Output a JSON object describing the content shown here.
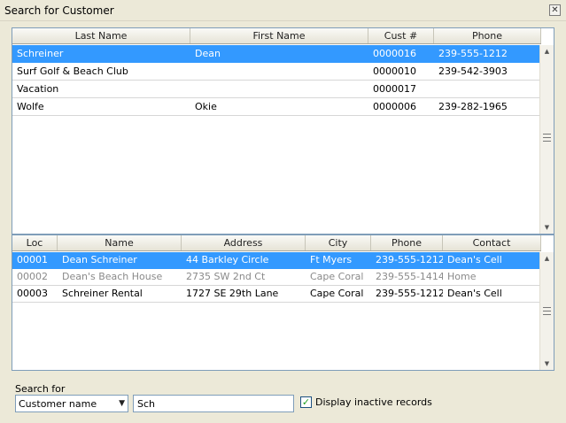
{
  "window": {
    "title": "Search for Customer",
    "close_glyph": "✕"
  },
  "customers": {
    "columns": [
      "Last Name",
      "First Name",
      "Cust #",
      "Phone"
    ],
    "rows": [
      {
        "last": "Schreiner",
        "first": "Dean",
        "cust": "0000016",
        "phone": "239-555-1212",
        "selected": true
      },
      {
        "last": "Surf Golf & Beach Club",
        "first": "",
        "cust": "0000010",
        "phone": "239-542-3903",
        "selected": false
      },
      {
        "last": "Vacation",
        "first": "",
        "cust": "0000017",
        "phone": "",
        "selected": false
      },
      {
        "last": "Wolfe",
        "first": "Okie",
        "cust": "0000006",
        "phone": "239-282-1965",
        "selected": false
      }
    ]
  },
  "locations": {
    "columns": [
      "Loc",
      "Name",
      "Address",
      "City",
      "Phone",
      "Contact"
    ],
    "rows": [
      {
        "loc": "00001",
        "name": "Dean Schreiner",
        "address": "44 Barkley Circle",
        "city": "Ft Myers",
        "phone": "239-555-1212",
        "contact": "Dean's Cell",
        "selected": true,
        "inactive": false
      },
      {
        "loc": "00002",
        "name": "Dean's Beach House",
        "address": "2735 SW 2nd Ct",
        "city": "Cape Coral",
        "phone": "239-555-1414",
        "contact": "Home",
        "selected": false,
        "inactive": true
      },
      {
        "loc": "00003",
        "name": "Schreiner Rental",
        "address": "1727 SE 29th Lane",
        "city": "Cape Coral",
        "phone": "239-555-1212",
        "contact": "Dean's Cell",
        "selected": false,
        "inactive": false
      }
    ]
  },
  "search": {
    "label": "Search for",
    "field_selected": "Customer name",
    "text_value": "Sch",
    "inactive_label": "Display inactive records",
    "inactive_checked": true,
    "check_glyph": "✓",
    "combo_arrow_glyph": "▼"
  },
  "scrollbar": {
    "up_glyph": "▲",
    "down_glyph": "▼"
  },
  "colors": {
    "selection": "#3399ff",
    "inactive_text": "#8a8a8a"
  },
  "icons": [
    "close-icon",
    "chevron-down-icon",
    "checkmark-icon",
    "scroll-up-icon",
    "scroll-down-icon"
  ]
}
